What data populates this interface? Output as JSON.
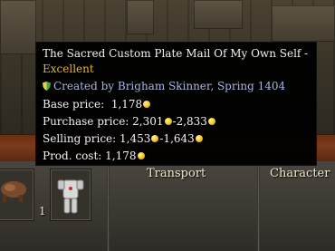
{
  "tooltip": {
    "title": "The Sacred Custom Plate Mail Of My Own Self -",
    "quality": "Excellent",
    "creator": "Created by Brigham Skinner, Spring 1404",
    "base_price_label": "Base price:",
    "base_price_value": "1,178",
    "purchase_price_label": "Purchase price:",
    "purchase_price_min": "2,301",
    "purchase_price_max": "-2,833",
    "selling_price_label": "Selling price:",
    "selling_price_min": "1,453",
    "selling_price_max": "-1,643",
    "prod_cost_label": "Prod. cost:",
    "prod_cost_value": "1,178"
  },
  "tabs": {
    "transport": "Transport",
    "character": "Character"
  },
  "inventory": {
    "slot_count": "1"
  },
  "icons": {
    "coin": "gold-coin-icon",
    "shield": "shield-icon"
  },
  "colors": {
    "title_text": "#f2f2f2",
    "quality_text": "#e7b142",
    "creator_text": "#aab6e0",
    "tooltip_bg": "#000000",
    "brown_bar": "#7b3a1c"
  }
}
